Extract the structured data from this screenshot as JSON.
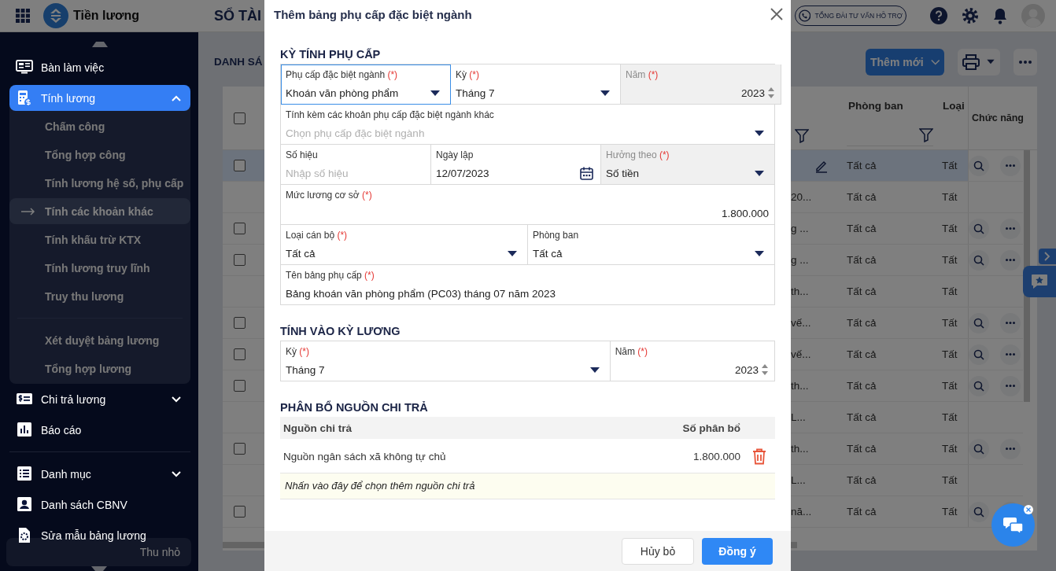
{
  "app": {
    "name": "Tiền lương",
    "heading": "SỔ TÀI",
    "hotline": "TỔNG ĐÀI TƯ VẤN HỖ TRỢ"
  },
  "sidebar": {
    "items": [
      {
        "label": "Bàn làm việc",
        "selected": false
      },
      {
        "label": "Tính lương",
        "selected": true,
        "expanded": true,
        "children": [
          {
            "label": "Chấm công",
            "selected": false
          },
          {
            "label": "Tổng hợp công",
            "selected": false
          },
          {
            "label": "Tính lương hệ số, phụ cấp",
            "selected": false
          },
          {
            "label": "Tính các khoản khác",
            "selected": true
          },
          {
            "label": "Tính khấu trừ KTX",
            "selected": false
          },
          {
            "label": "Tính lương truy lĩnh",
            "selected": false
          },
          {
            "label": "Truy thu lương",
            "selected": false
          },
          {
            "label": "Xét duyệt bảng lương",
            "selected": false,
            "divider_before": true
          },
          {
            "label": "Tổng hợp lương",
            "selected": false
          }
        ]
      },
      {
        "label": "Chi trả lương",
        "selected": false,
        "expanded": false
      },
      {
        "label": "Báo cáo",
        "selected": false
      },
      {
        "label": "Danh mục",
        "selected": false,
        "expanded": false,
        "divider_before": true
      },
      {
        "label": "Danh sách CBNV",
        "selected": false
      },
      {
        "label": "Sửa mẫu bảng lương",
        "selected": false
      }
    ],
    "collapse": "Thu nhỏ"
  },
  "page": {
    "title": "DANH SÁ",
    "add_button": "Thêm mới",
    "table": {
      "columns": [
        {
          "kind": "check",
          "checked": false
        },
        {
          "kind": "text",
          "filter": true
        },
        {
          "kind": "text",
          "label": "Phòng ban",
          "filter": true
        },
        {
          "kind": "text",
          "label": "Loại"
        },
        {
          "kind": "actions",
          "label": "Chức năng"
        }
      ],
      "rows": [
        {
          "kind": "item",
          "selected": true,
          "checked": false,
          "department": "Tất cả",
          "column_4": "Tất"
        },
        {
          "kind": "group",
          "selected": false,
          "column_2": "20...",
          "department": "Tất cả",
          "column_4": "Tất"
        },
        {
          "kind": "item",
          "selected": false,
          "checked": false,
          "column_2": "g ...",
          "department": "Tất cả",
          "column_4": "Tất"
        },
        {
          "kind": "item",
          "selected": false,
          "checked": false,
          "column_2": "g ...",
          "department": "Tất cả",
          "column_4": "Tất"
        },
        {
          "kind": "group",
          "selected": false,
          "column_2": "th...",
          "department": "Tất cả",
          "column_4": "Tất"
        },
        {
          "kind": "item",
          "selected": false,
          "checked": false,
          "column_2": "vế...",
          "department": "Tất cả",
          "column_4": "Tất"
        },
        {
          "kind": "item",
          "selected": false,
          "checked": false,
          "column_2": "vế...",
          "department": "Tất cả",
          "column_4": "Tất"
        },
        {
          "kind": "item",
          "selected": false,
          "checked": false,
          "column_2": "th...",
          "department": "Tất cả",
          "column_4": "Tất"
        },
        {
          "kind": "group",
          "selected": false,
          "column_2": "L...",
          "department": "Tất cả",
          "column_4": "Tất"
        },
        {
          "kind": "item",
          "selected": false,
          "checked": false,
          "column_2": "th...",
          "department": "Tất cả",
          "column_4": "Tất"
        },
        {
          "kind": "group",
          "selected": false,
          "column_2": "L...",
          "department": "Tất cả",
          "column_4": "Tất"
        },
        {
          "kind": "item",
          "selected": false,
          "checked": false,
          "column_2": "nă...",
          "department": "Tất cả",
          "column_4": "Tất"
        }
      ]
    }
  },
  "dialog": {
    "title": "Thêm bảng phụ cấp đặc biệt ngành",
    "sections": [
      {
        "heading": "KỲ TÍNH PHỤ CẤP",
        "rows": [
          [
            {
              "label": "Phụ cấp đặc biệt ngành",
              "mark": "(*)",
              "kind": "select",
              "value": "Khoán văn phòng phẩm",
              "focused": true,
              "disabled": false
            },
            {
              "label": "Kỳ",
              "mark": "(*)",
              "kind": "select",
              "value": "Tháng 7",
              "focused": false,
              "disabled": false
            },
            {
              "label": "Năm",
              "mark": "(*)",
              "kind": "number",
              "value": "2023",
              "focused": false,
              "disabled": true
            }
          ],
          [
            {
              "label": "Tính kèm các khoản phụ cấp đặc biệt ngành khác",
              "kind": "select",
              "placeholder": "Chọn phụ cấp đặc biệt ngành",
              "focused": false,
              "disabled": false
            }
          ],
          [
            {
              "label": "Số hiệu",
              "kind": "text",
              "placeholder": "Nhập số hiệu",
              "focused": false,
              "disabled": false
            },
            {
              "label": "Ngày lập",
              "kind": "date",
              "value": "12/07/2023",
              "focused": false,
              "disabled": false
            },
            {
              "label": "Hưởng theo",
              "mark": "(*)",
              "kind": "select",
              "value": "Số tiền",
              "focused": false,
              "disabled": true
            }
          ],
          [
            {
              "label": "Mức lương cơ sở",
              "mark": "(*)",
              "kind": "amount",
              "value": "1.800.000",
              "focused": false,
              "disabled": false
            }
          ],
          [
            {
              "label": "Loại cán bộ",
              "mark": "(*)",
              "kind": "select",
              "value": "Tất cả",
              "focused": false,
              "disabled": false
            },
            {
              "label": "Phòng ban",
              "kind": "select",
              "value": "Tất cả",
              "focused": false,
              "disabled": false
            }
          ],
          [
            {
              "label": "Tên bảng phụ cấp",
              "mark": "(*)",
              "kind": "text",
              "value": "Bảng khoán văn phòng phẩm (PC03) tháng 07 năm 2023",
              "focused": false,
              "disabled": false
            }
          ]
        ]
      },
      {
        "heading": "TÍNH VÀO KỲ LƯƠNG",
        "rows": [
          [
            {
              "label": "Kỳ",
              "mark": "(*)",
              "kind": "select",
              "value": "Tháng 7",
              "focused": false,
              "disabled": false
            },
            {
              "label": "Năm",
              "mark": "(*)",
              "kind": "number",
              "value": "2023",
              "focused": false,
              "disabled": false
            }
          ]
        ]
      }
    ],
    "allocation": {
      "heading": "PHÂN BỔ NGUỒN CHI TRẢ",
      "columns": [
        "Nguồn chi trả",
        "Số phân bổ"
      ],
      "rows": [
        {
          "source": "Nguồn ngân sách xã không tự chủ",
          "amount": "1.800.000"
        }
      ],
      "add_hint": "Nhấn vào đây để chọn thêm nguồn chi trả"
    },
    "buttons": [
      {
        "label": "Hủy bỏ",
        "kind": "secondary"
      },
      {
        "label": "Đồng ý",
        "kind": "primary"
      }
    ]
  }
}
